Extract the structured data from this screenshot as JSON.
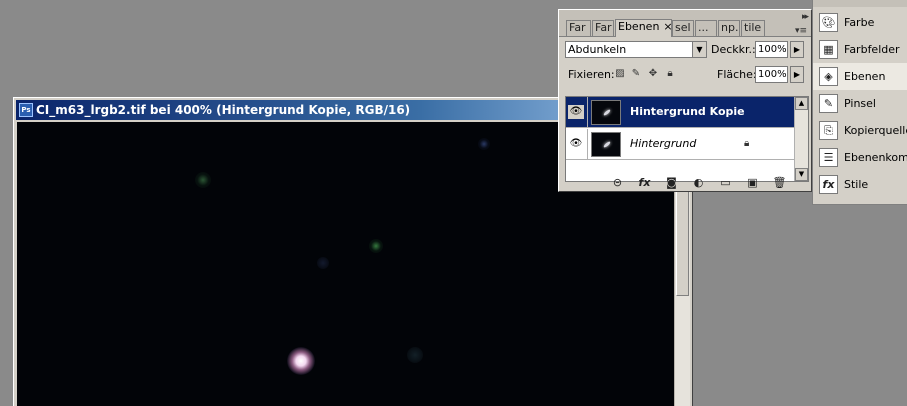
{
  "document": {
    "title": "CI_m63_lrgb2.tif bei 400% (Hintergrund Kopie, RGB/16)",
    "app_icon": "photoshop-doc-icon"
  },
  "layers_panel": {
    "tabs": [
      {
        "label": "Far"
      },
      {
        "label": "Far"
      },
      {
        "label": "Ebenen",
        "active": true,
        "close": "×"
      },
      {
        "label": "sel"
      },
      {
        "label": "..."
      },
      {
        "label": "np."
      },
      {
        "label": "tile"
      }
    ],
    "blend_mode": "Abdunkeln",
    "opacity_label": "Deckkr.:",
    "opacity_value": "100%",
    "lock_label": "Fixieren:",
    "fill_label": "Fläche:",
    "fill_value": "100%",
    "layers": [
      {
        "name": "Hintergrund Kopie",
        "selected": true,
        "visible": true
      },
      {
        "name": "Hintergrund",
        "selected": false,
        "visible": true,
        "locked": true
      }
    ],
    "bottom_icons": [
      "link-icon",
      "fx-icon",
      "mask-icon",
      "adjustment-icon",
      "folder-icon",
      "new-layer-icon",
      "trash-icon"
    ],
    "fx_label": "fx"
  },
  "dock": {
    "items": [
      {
        "label": "Farbe",
        "icon": "palette-icon"
      },
      {
        "label": "Farbfelder",
        "icon": "swatches-icon"
      },
      {
        "label": "Ebenen",
        "icon": "layers-icon",
        "active": true
      },
      {
        "label": "Pinsel",
        "icon": "brush-icon"
      },
      {
        "label": "Kopierquelle",
        "icon": "clone-source-icon"
      },
      {
        "label": "Ebenenkomp",
        "icon": "layer-comps-icon"
      },
      {
        "label": "Stile",
        "icon": "styles-icon"
      }
    ]
  },
  "colors": {
    "selection": "#0a246a",
    "titlebar": "#0a246a",
    "canvas": "#020408"
  }
}
